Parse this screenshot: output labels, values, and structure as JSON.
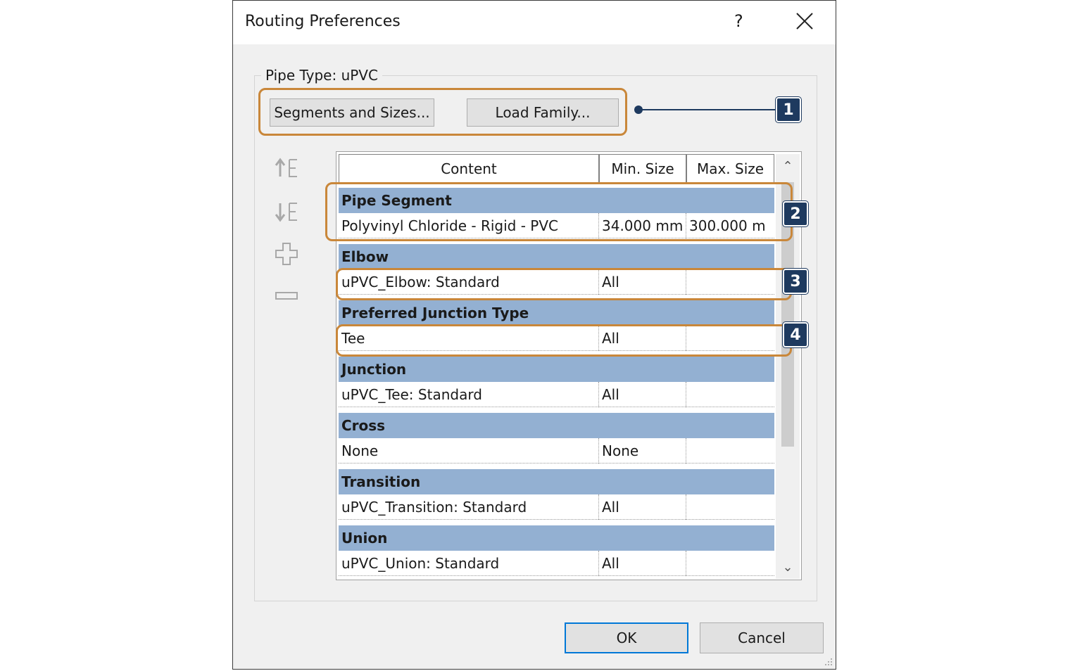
{
  "window": {
    "title": "Routing Preferences",
    "help_label": "?"
  },
  "group": {
    "label": "Pipe Type: uPVC"
  },
  "buttons": {
    "segments": "Segments and Sizes...",
    "load_family": "Load Family...",
    "ok": "OK",
    "cancel": "Cancel"
  },
  "table": {
    "headers": [
      "Content",
      "Min. Size",
      "Max. Size"
    ],
    "rows": [
      {
        "group": "Pipe Segment",
        "content": "Polyvinyl Chloride - Rigid - PVC",
        "min": "34.000 mm",
        "max": "300.000 m"
      },
      {
        "group": "Elbow",
        "content": "uPVC_Elbow: Standard",
        "min": "All",
        "max": ""
      },
      {
        "group": "Preferred Junction Type",
        "content": "Tee",
        "min": "All",
        "max": ""
      },
      {
        "group": "Junction",
        "content": "uPVC_Tee: Standard",
        "min": "All",
        "max": ""
      },
      {
        "group": "Cross",
        "content": "None",
        "min": "None",
        "max": ""
      },
      {
        "group": "Transition",
        "content": "uPVC_Transition: Standard",
        "min": "All",
        "max": ""
      },
      {
        "group": "Union",
        "content": "uPVC_Union: Standard",
        "min": "All",
        "max": ""
      }
    ]
  },
  "callouts": [
    "1",
    "2",
    "3",
    "4"
  ],
  "side_icons": [
    "move-up-icon",
    "move-down-icon",
    "add-row-icon",
    "remove-row-icon"
  ],
  "colors": {
    "group_row": "#93b0d2",
    "highlight": "#c9873a",
    "callout": "#1e3a5f",
    "ok_border": "#0078d7"
  }
}
